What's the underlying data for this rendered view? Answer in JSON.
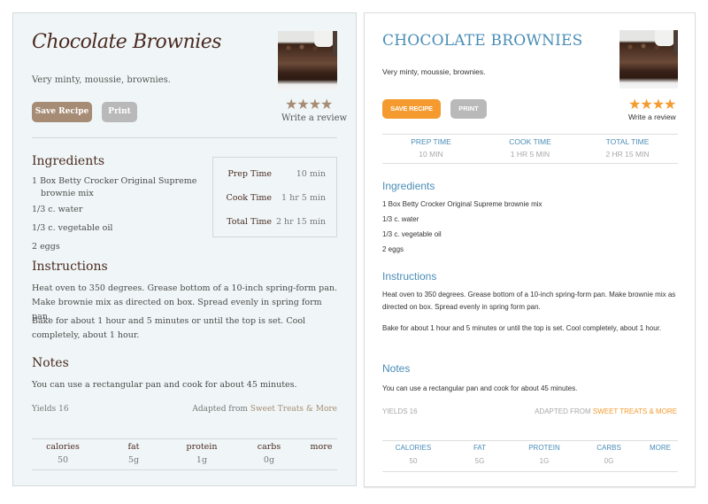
{
  "colors": {
    "classic_accent": "#a68b75",
    "classic_title": "#4a2a22",
    "classic_bg": "#f0f6f7",
    "modern_accent": "#f49a2f",
    "modern_title": "#4a8db7",
    "print_button": "#b9b9b9"
  },
  "classic": {
    "title": "Chocolate Brownies",
    "description": "Very minty, moussie, brownies.",
    "save_label": "Save Recipe",
    "print_label": "Print",
    "rating_stars": 4,
    "stars_glyph": "★★★★",
    "write_review": "Write a review",
    "times": [
      {
        "label": "Prep Time",
        "value": "10 min"
      },
      {
        "label": "Cook Time",
        "value": "1 hr 5 min"
      },
      {
        "label": "Total Time",
        "value": "2 hr 15 min"
      }
    ],
    "ingredients_heading": "Ingredients",
    "ingredients": [
      "1 Box Betty Crocker Original Supreme brownie mix",
      "1/3 c. water",
      "1/3 c. vegetable oil",
      "2 eggs"
    ],
    "instructions_heading": "Instructions",
    "instructions": [
      "Heat oven to 350 degrees. Grease bottom of a 10-inch spring-form pan. Make brownie mix as directed on box. Spread evenly in spring form pan.",
      "Bake for about 1 hour and 5 minutes or until the top is set. Cool completely, about 1 hour."
    ],
    "notes_heading": "Notes",
    "notes": "You can use a rectangular pan and cook for about 45 minutes.",
    "yields": "Yields 16",
    "adapted_prefix": "Adapted from ",
    "adapted_source": "Sweet Treats & More",
    "nutrition": [
      {
        "label": "calories",
        "value": "50"
      },
      {
        "label": "fat",
        "value": "5g"
      },
      {
        "label": "protein",
        "value": "1g"
      },
      {
        "label": "carbs",
        "value": "0g"
      },
      {
        "label": "more",
        "value": ""
      }
    ]
  },
  "modern": {
    "title": "CHOCOLATE BROWNIES",
    "description": "Very minty, moussie, brownies.",
    "save_label": "SAVE RECIPE",
    "print_label": "PRINT",
    "rating_stars": 4,
    "stars_glyph": "★★★★",
    "write_review": "Write a review",
    "times": [
      {
        "label": "PREP TIME",
        "value": "10 MIN"
      },
      {
        "label": "COOK TIME",
        "value": "1 HR 5 MIN"
      },
      {
        "label": "TOTAL TIME",
        "value": "2 HR 15 MIN"
      }
    ],
    "ingredients_heading": "Ingredients",
    "ingredients": [
      "1 Box Betty Crocker Original Supreme brownie mix",
      "1/3 c. water",
      "1/3 c. vegetable oil",
      "2 eggs"
    ],
    "instructions_heading": "Instructions",
    "instructions": [
      "Heat oven to 350 degrees. Grease bottom of a 10-inch spring-form pan. Make brownie mix as directed on box. Spread evenly in spring form pan.",
      "Bake for about 1 hour and 5 minutes or until the top is set. Cool completely, about 1 hour."
    ],
    "notes_heading": "Notes",
    "notes": "You can use a rectangular pan and cook for about 45 minutes.",
    "yields": "YIELDS 16",
    "adapted_prefix": "ADAPTED FROM ",
    "adapted_source": "SWEET TREATS & MORE",
    "nutrition": [
      {
        "label": "CALORIES",
        "value": "50"
      },
      {
        "label": "FAT",
        "value": "5G"
      },
      {
        "label": "PROTEIN",
        "value": "1G"
      },
      {
        "label": "CARBS",
        "value": "0G"
      },
      {
        "label": "MORE",
        "value": ""
      }
    ]
  }
}
